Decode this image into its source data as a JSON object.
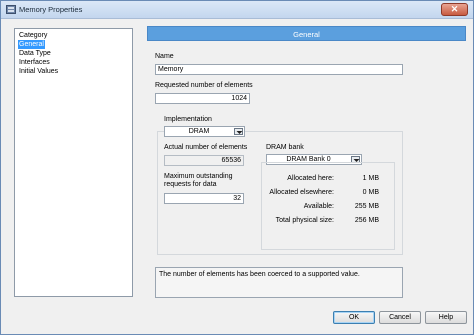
{
  "window": {
    "title": "Memory Properties",
    "close_label": "✕"
  },
  "sidebar": {
    "items": [
      {
        "label": "Category",
        "selected": false
      },
      {
        "label": "General",
        "selected": true
      },
      {
        "label": "Data Type",
        "selected": false
      },
      {
        "label": "Interfaces",
        "selected": false
      },
      {
        "label": "Initial Values",
        "selected": false
      }
    ]
  },
  "general": {
    "header": "General",
    "name_label": "Name",
    "name_value": "Memory",
    "requested_label": "Requested number of elements",
    "requested_value": "1024",
    "implementation_label": "Implementation",
    "implementation_value": "DRAM",
    "actual_label": "Actual number of elements",
    "actual_value": "65536",
    "max_requests_label_1": "Maximum outstanding",
    "max_requests_label_2": "requests for data",
    "max_requests_value": "32",
    "dram_bank_label": "DRAM bank",
    "dram_bank_value": "DRAM Bank 0",
    "stats": [
      {
        "label": "Allocated here:",
        "value": "1 MB"
      },
      {
        "label": "Allocated elsewhere:",
        "value": "0 MB"
      },
      {
        "label": "Available:",
        "value": "255 MB"
      },
      {
        "label": "Total physical size:",
        "value": "256 MB"
      }
    ]
  },
  "message": "The number of elements has been coerced to a supported value.",
  "buttons": {
    "ok": "OK",
    "cancel": "Cancel",
    "help": "Help"
  }
}
